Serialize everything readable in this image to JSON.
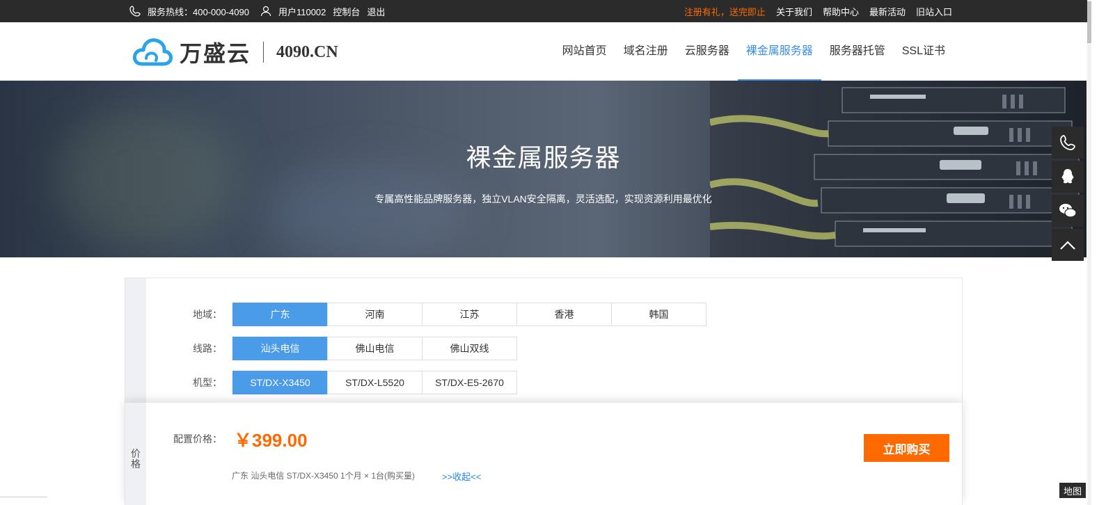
{
  "topbar": {
    "hotline": "服务热线：400-000-4090",
    "user": "用户110002",
    "console": "控制台",
    "logout": "退出",
    "promo": "注册有礼，送完即止",
    "about": "关于我们",
    "help": "帮助中心",
    "events": "最新活动",
    "old_entry": "旧站入口"
  },
  "logo": {
    "brand": "万盛云",
    "domain": "4090.CN"
  },
  "nav": [
    {
      "label": "网站首页",
      "active": false
    },
    {
      "label": "域名注册",
      "active": false
    },
    {
      "label": "云服务器",
      "active": false
    },
    {
      "label": "裸金属服务器",
      "active": true
    },
    {
      "label": "服务器托管",
      "active": false
    },
    {
      "label": "SSL证书",
      "active": false
    }
  ],
  "banner": {
    "title": "裸金属服务器",
    "subtitle": "专属高性能品牌服务器，独立VLAN安全隔离，灵活选配，实现资源利用最优化"
  },
  "config": {
    "region": {
      "label": "地域：",
      "options": [
        "广东",
        "河南",
        "江苏",
        "香港",
        "韩国"
      ]
    },
    "line": {
      "label": "线路：",
      "options": [
        "汕头电信",
        "佛山电信",
        "佛山双线"
      ]
    },
    "model": {
      "label": "机型：",
      "options": [
        "ST/DX-X3450",
        "ST/DX-L5520",
        "ST/DX-E5-2670"
      ]
    }
  },
  "price": {
    "side_label": "价格",
    "label": "配置价格：",
    "amount": "￥399.00",
    "summary": "广东  汕头电信  ST/DX-X3450  1个月 × 1台(购买量)",
    "toggle": ">>收起<<",
    "buy": "立即购买"
  },
  "map_label": "地图",
  "colors": {
    "accent": "#3a8ee6",
    "selected": "#4a9be8",
    "orange": "#ff6a00",
    "dark": "#2b2b2b"
  }
}
